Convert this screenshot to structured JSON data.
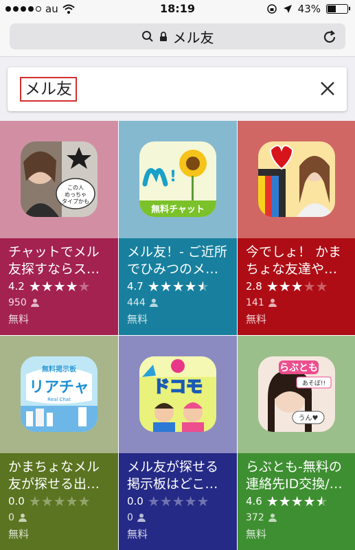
{
  "status_bar": {
    "carrier": "au",
    "time": "18:19",
    "battery": "43%"
  },
  "browser": {
    "url_text": "メル友"
  },
  "search": {
    "query": "メル友"
  },
  "apps": [
    {
      "title": "チャットでメル友探すならス…",
      "rating": "4.2",
      "stars": 4,
      "count": "950",
      "price": "無料",
      "top_color": "#d28fa4",
      "bottom_color": "#a3224f",
      "icon_label": "この人めっちゃタイプかも"
    },
    {
      "title": "メル友！- ご近所でひみつのメ…",
      "rating": "4.7",
      "stars": 4.5,
      "count": "444",
      "price": "無料",
      "top_color": "#85b9cf",
      "bottom_color": "#18809e",
      "icon_label": "無料チャット"
    },
    {
      "title": "今でしょ！ かまちょな友達や…",
      "rating": "2.8",
      "stars": 3,
      "count": "141",
      "price": "無料",
      "top_color": "#d06765",
      "bottom_color": "#ae0d15",
      "icon_label": ""
    },
    {
      "title": "かまちょなメル友が探せる出…",
      "rating": "0.0",
      "stars": 0,
      "count": "0",
      "price": "無料",
      "top_color": "#a8b58a",
      "bottom_color": "#5b7421",
      "icon_label": "リアチャ"
    },
    {
      "title": "メル友が探せる掲示板はどこ…",
      "rating": "0.0",
      "stars": 0,
      "count": "0",
      "price": "無料",
      "top_color": "#8b8bc2",
      "bottom_color": "#252a86",
      "icon_label": "ドコモ"
    },
    {
      "title": "らぶとも-無料の連絡先ID交換/…",
      "rating": "4.6",
      "stars": 4.5,
      "count": "372",
      "price": "無料",
      "top_color": "#9bbf8a",
      "bottom_color": "#3e8f31",
      "icon_label": "らぶとも"
    }
  ]
}
